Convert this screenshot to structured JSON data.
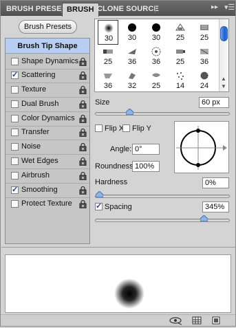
{
  "tabs": [
    {
      "label": "BRUSH PRESETS",
      "active": false
    },
    {
      "label": "BRUSH",
      "active": true
    },
    {
      "label": "CLONE SOURCE",
      "active": false
    }
  ],
  "brush_presets_button": "Brush Presets",
  "tip_shape_label": "Brush Tip Shape",
  "options": [
    {
      "label": "Shape Dynamics",
      "checked": false
    },
    {
      "label": "Scattering",
      "checked": true
    },
    {
      "label": "Texture",
      "checked": false
    },
    {
      "label": "Dual Brush",
      "checked": false
    },
    {
      "label": "Color Dynamics",
      "checked": false
    },
    {
      "label": "Transfer",
      "checked": false
    },
    {
      "label": "Noise",
      "checked": false
    },
    {
      "label": "Wet Edges",
      "checked": false
    },
    {
      "label": "Airbrush",
      "checked": false
    },
    {
      "label": "Smoothing",
      "checked": true
    },
    {
      "label": "Protect Texture",
      "checked": false
    }
  ],
  "brush_tips": {
    "row1": [
      "30",
      "30",
      "30",
      "25",
      "25"
    ],
    "row2": [
      "25",
      "36",
      "36",
      "25",
      "36"
    ],
    "row3": [
      "36",
      "32",
      "25",
      "14",
      "24"
    ],
    "selected_index": 0
  },
  "size": {
    "label": "Size",
    "value": "60 px",
    "slider_fraction": 0.24
  },
  "flip_x": {
    "label": "Flip X",
    "checked": false
  },
  "flip_y": {
    "label": "Flip Y",
    "checked": false
  },
  "angle": {
    "label": "Angle:",
    "value": "0°"
  },
  "roundness": {
    "label": "Roundness:",
    "value": "100%"
  },
  "hardness": {
    "label": "Hardness",
    "value": "0%",
    "slider_fraction": 0.0
  },
  "spacing": {
    "label": "Spacing",
    "checked": true,
    "value": "345%",
    "slider_fraction": 0.82
  },
  "icons": {
    "lock": "lock-icon",
    "eye": "eye-icon",
    "new_preset": "new-preset-icon",
    "panel_menu": "panel-menu-icon",
    "collapse": "collapse-icon"
  },
  "colors": {
    "tip_shape_highlight": "#b7cef0",
    "tab_bar": "#5e5e5e",
    "checkmark": "#1b3f9b"
  }
}
